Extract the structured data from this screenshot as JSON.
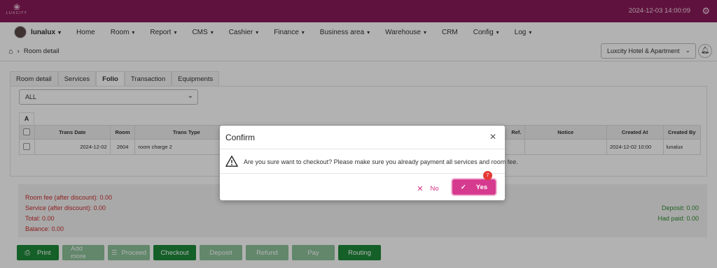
{
  "app": {
    "logo_text": "LUXCITY",
    "clock": "2024-12-03 14:00:09",
    "icons": {
      "logo": "lotus-logo-icon",
      "settings": "gear-icon",
      "home": "home-icon",
      "bell": "bell-icon"
    }
  },
  "nav": {
    "user": "lunalux",
    "items": [
      "Home",
      "Room",
      "Report",
      "CMS",
      "Cashier",
      "Finance",
      "Business area",
      "Warehouse",
      "CRM",
      "Config",
      "Log"
    ],
    "has_dropdown": [
      false,
      true,
      true,
      true,
      true,
      true,
      true,
      true,
      false,
      true,
      true
    ]
  },
  "breadcrumb": {
    "page": "Room detail"
  },
  "hotel_selector": {
    "value": "Luxcity Hotel & Apartment"
  },
  "tabs": {
    "items": [
      "Room detail",
      "Services",
      "Folio",
      "Transaction",
      "Equipments"
    ],
    "active": "Folio"
  },
  "folio": {
    "filter_value": "ALL",
    "subtab": "A",
    "columns": [
      "Trans Date",
      "Room",
      "Trans Type",
      "Ref.",
      "Notice",
      "Created At",
      "Created By"
    ],
    "rows": [
      {
        "trans_date": "2024-12-02",
        "room": "2604",
        "trans_type": "room charge 2",
        "ref": "",
        "notice": "",
        "created_at": "2024-12-02 10:00",
        "created_by": "lunalux"
      }
    ]
  },
  "summary": {
    "room_fee": "Room fee (after discount): 0.00",
    "service": "Service (after discount): 0.00",
    "total": "Total: 0.00",
    "balance": "Balance: 0.00",
    "deposit": "Deposit: 0.00",
    "had_paid": "Had paid: 0.00"
  },
  "actions": {
    "print": "Print",
    "add_more": "Add more",
    "proceed": "Proceed",
    "checkout": "Checkout",
    "deposit": "Deposit",
    "refund": "Refund",
    "pay": "Pay",
    "routing": "Routing"
  },
  "dialog": {
    "title": "Confirm",
    "message": "Are you sure want to checkout? Please make sure you already payment all services and room fee.",
    "no_label": "No",
    "yes_label": "Yes",
    "badge": "7",
    "colors": {
      "accent": "#d63a8f",
      "brand": "#8a1a5a",
      "danger": "#cc2f2f",
      "success": "#2e8b2e"
    }
  }
}
